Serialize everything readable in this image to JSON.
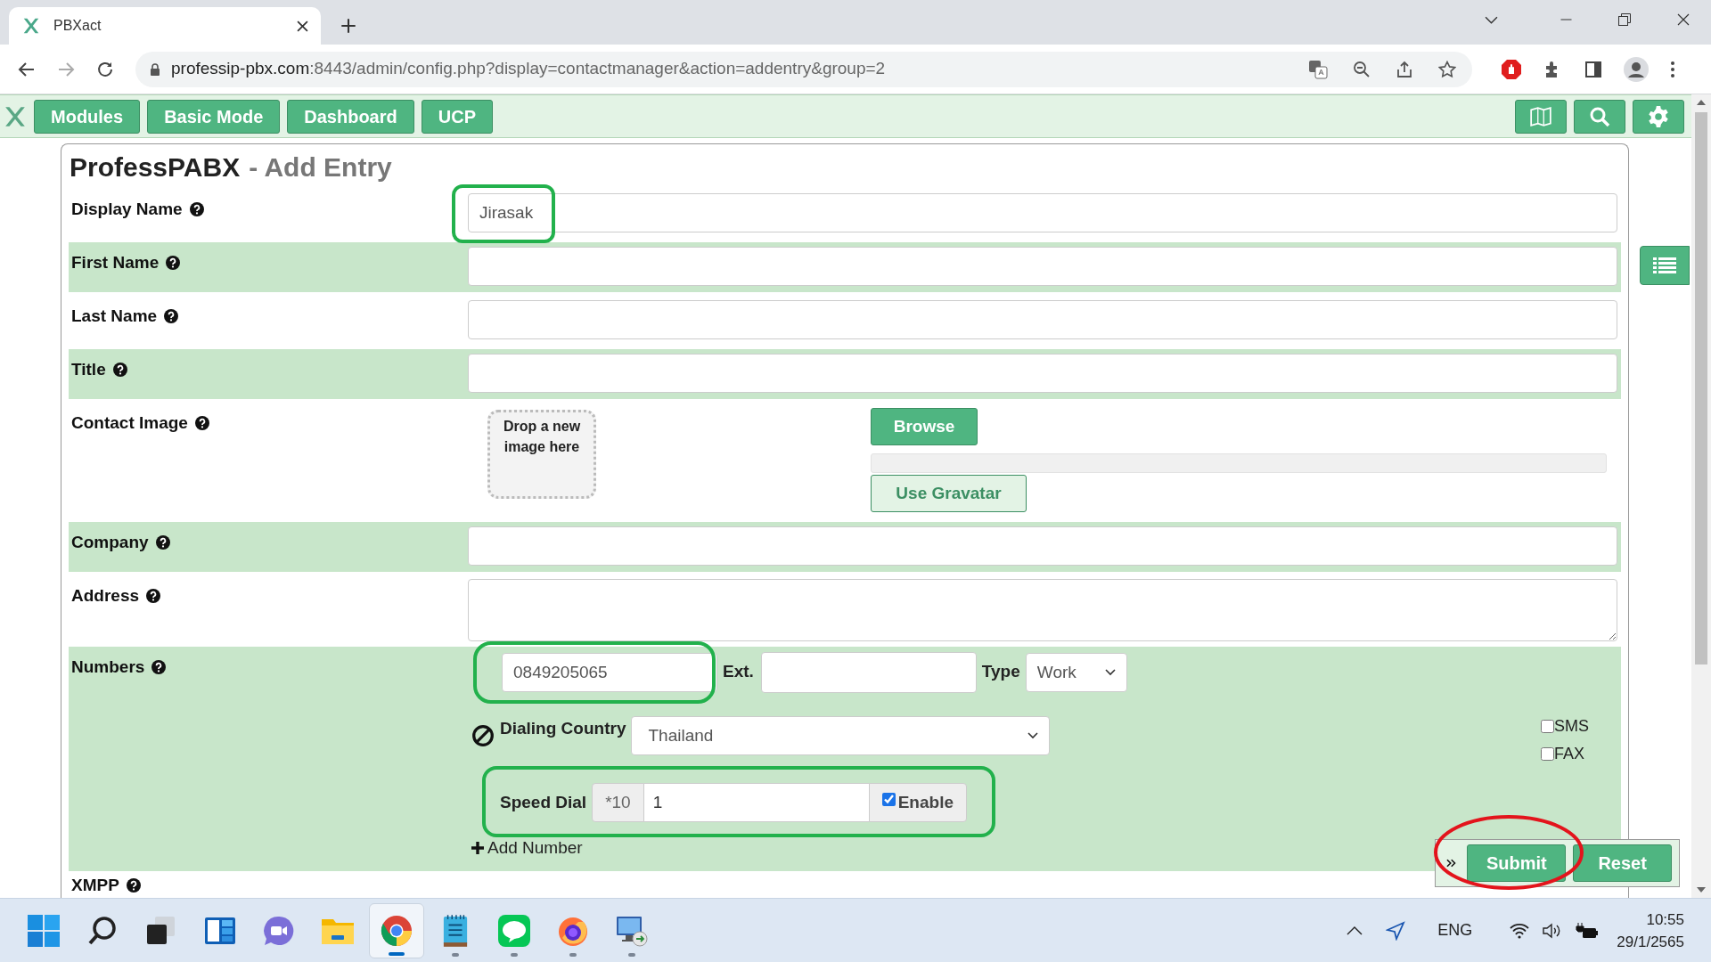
{
  "browser": {
    "tab": {
      "title": "PBXact"
    },
    "url": {
      "host": "professip-pbx.com",
      "path": ":8443/admin/config.php?display=contactmanager&action=addentry&group=2"
    }
  },
  "nav": {
    "buttons": [
      "Modules",
      "Basic Mode",
      "Dashboard",
      "UCP"
    ]
  },
  "page": {
    "title": "ProfessPABX",
    "subtitle": "- Add Entry"
  },
  "fields": [
    {
      "label": "Display Name",
      "kind": "text",
      "value": "Jirasak",
      "highlighted": true
    },
    {
      "label": "First Name",
      "kind": "text",
      "highlighted": false
    },
    {
      "label": "Last Name",
      "kind": "text",
      "highlighted": false
    },
    {
      "label": "Title",
      "kind": "text",
      "highlighted": false
    },
    {
      "label": "Contact Image",
      "kind": "image",
      "drop_text": "Drop a new image here",
      "browse": "Browse",
      "gravatar": "Use Gravatar",
      "level": 0,
      "highlighted": false
    },
    {
      "label": "Company",
      "kind": "text",
      "highlighted": false
    },
    {
      "label": "Address",
      "kind": "textarea",
      "highlighted": false
    },
    {
      "label": "Numbers",
      "kind": "numbers",
      "highlighted": false
    },
    {
      "label": "XMPP",
      "kind": "cut",
      "highlighted": false
    }
  ],
  "numbers": {
    "number": "0849205065",
    "highlighted": true,
    "ext_label": "Ext.",
    "type_label": "Type",
    "type": "Work",
    "country_label": "Dialing Country",
    "country": "Thailand",
    "flags": [
      {
        "label": "SMS",
        "checked": false
      },
      {
        "label": "FAX",
        "checked": false
      }
    ],
    "speed_dial": {
      "label": "Speed Dial",
      "prefix": "*10",
      "value": "1",
      "enable_label": "Enable",
      "enabled": true,
      "highlighted": true
    },
    "add_label": "Add Number"
  },
  "footer": {
    "buttons": [
      {
        "label": "Submit",
        "circled": true
      },
      {
        "label": "Reset",
        "circled": false
      }
    ]
  },
  "taskbar": {
    "apps": [
      {
        "kind": "start",
        "selected": false,
        "running": false
      },
      {
        "kind": "search",
        "selected": false,
        "running": false
      },
      {
        "kind": "taskview",
        "selected": false,
        "running": false
      },
      {
        "kind": "widgets",
        "selected": false,
        "running": false
      },
      {
        "kind": "chat",
        "selected": false,
        "running": false
      },
      {
        "kind": "folder",
        "selected": false,
        "running": false
      },
      {
        "kind": "chrome",
        "selected": true,
        "running": true
      },
      {
        "kind": "notepad",
        "selected": false,
        "running": true
      },
      {
        "kind": "line",
        "selected": false,
        "running": true
      },
      {
        "kind": "firefox",
        "selected": false,
        "running": true
      },
      {
        "kind": "remote",
        "selected": false,
        "running": true
      }
    ],
    "language": "ENG",
    "time": "10:55",
    "date": "29/1/2565"
  }
}
